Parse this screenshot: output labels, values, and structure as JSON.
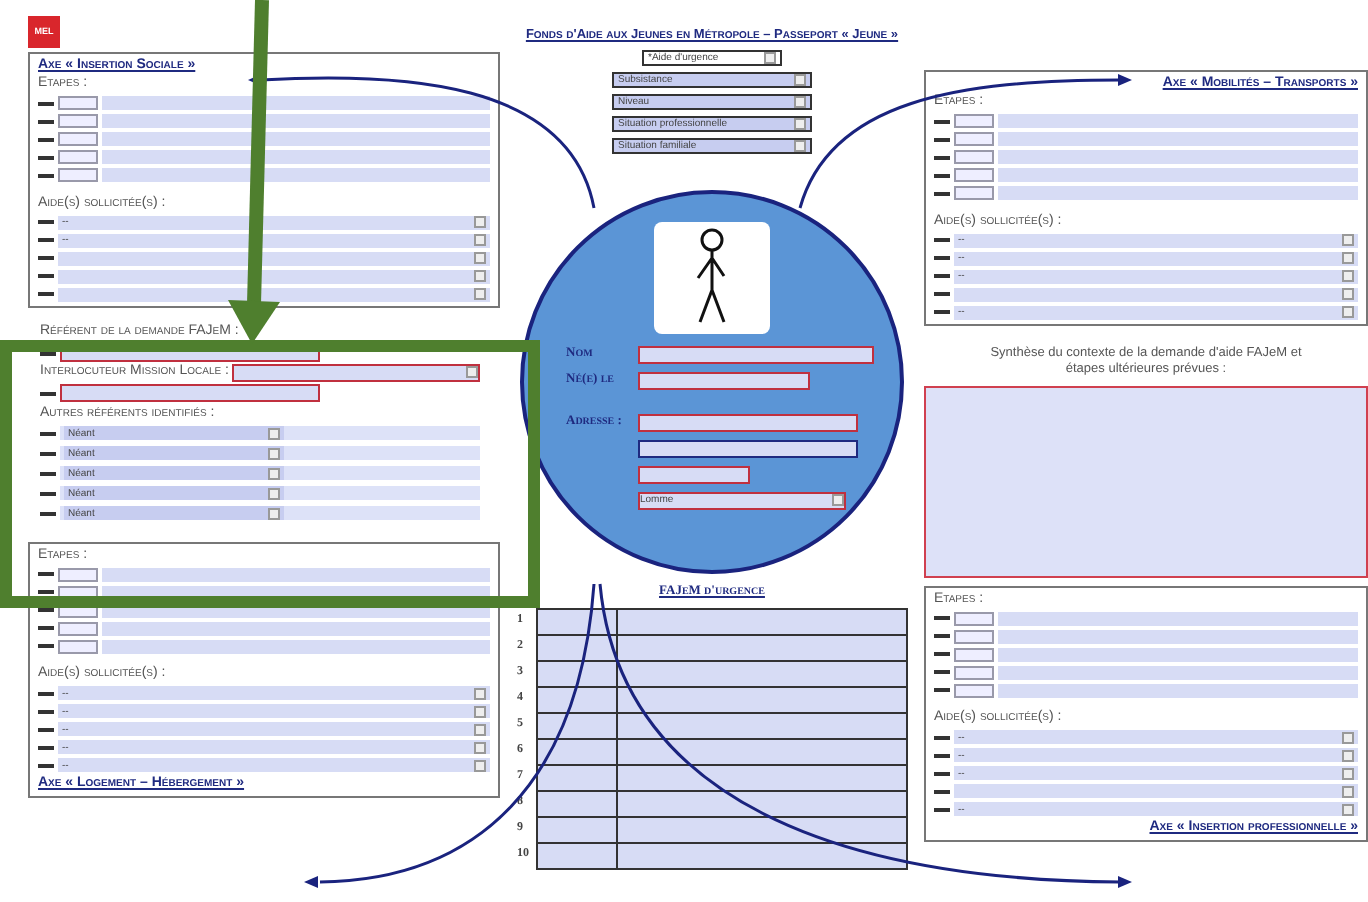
{
  "logo": {
    "text": "MEL"
  },
  "title": "Fonds d'Aide aux Jeunes en Métropole – Passeport « Jeune »",
  "aid_type": {
    "value": "*Aide d'urgence"
  },
  "header_selects": [
    {
      "value": "Subsistance"
    },
    {
      "value": "Niveau"
    },
    {
      "value": "Situation professionnelle"
    },
    {
      "value": "Situation familiale"
    }
  ],
  "axes": [
    {
      "title": "Axe « Insertion Sociale »",
      "steps_label": "Etapes :",
      "aids_label": "Aide(s) sollicitée(s) :",
      "aids": [
        {
          "kind": "select",
          "value": "--"
        },
        {
          "kind": "select",
          "value": "--"
        },
        {
          "kind": "blank"
        },
        {
          "kind": "blank"
        },
        {
          "kind": "blank"
        }
      ]
    },
    {
      "title": "Axe « Mobilités – Transports »",
      "steps_label": "Etapes :",
      "aids_label": "Aide(s) sollicitée(s) :",
      "aids": [
        {
          "kind": "select",
          "value": "--"
        },
        {
          "kind": "select",
          "value": "--"
        },
        {
          "kind": "select",
          "value": "--"
        },
        {
          "kind": "blank"
        },
        {
          "kind": "select",
          "value": "--"
        }
      ]
    },
    {
      "title": "Axe « Logement – Hébergement »",
      "steps_label": "Etapes :",
      "aids_label": "Aide(s) sollicitée(s) :",
      "aids": [
        {
          "kind": "select",
          "value": "--"
        },
        {
          "kind": "select",
          "value": "--"
        },
        {
          "kind": "select",
          "value": "--"
        },
        {
          "kind": "select",
          "value": "--"
        },
        {
          "kind": "select",
          "value": "--"
        }
      ]
    },
    {
      "title": "Axe « Insertion professionnelle »",
      "steps_label": "Etapes :",
      "aids_label": "Aide(s) sollicitée(s) :",
      "aids": [
        {
          "kind": "select",
          "value": "--"
        },
        {
          "kind": "select",
          "value": "--"
        },
        {
          "kind": "select",
          "value": "--"
        },
        {
          "kind": "blank"
        },
        {
          "kind": "select",
          "value": "--"
        }
      ]
    }
  ],
  "referents": {
    "referent_label": "Référent de la demande FAJeM :",
    "interlocutor_label": "Interlocuteur Mission Locale :",
    "others_label": "Autres référents identifiés :",
    "others": [
      {
        "value": "Néant"
      },
      {
        "value": "Néant"
      },
      {
        "value": "Néant"
      },
      {
        "value": "Néant"
      },
      {
        "value": "Néant"
      }
    ]
  },
  "identity": {
    "labels": [
      "Nom",
      "Né(e) le",
      "Adresse :"
    ],
    "city": {
      "value": "Lomme"
    }
  },
  "synthesis": {
    "label": "Synthèse du contexte de la demande d'aide FAJeM et étapes ultérieures prévues :"
  },
  "urgency": {
    "title": "FAJeM d'urgence",
    "rows": [
      "1",
      "2",
      "3",
      "4",
      "5",
      "6",
      "7",
      "8",
      "9",
      "10"
    ]
  }
}
